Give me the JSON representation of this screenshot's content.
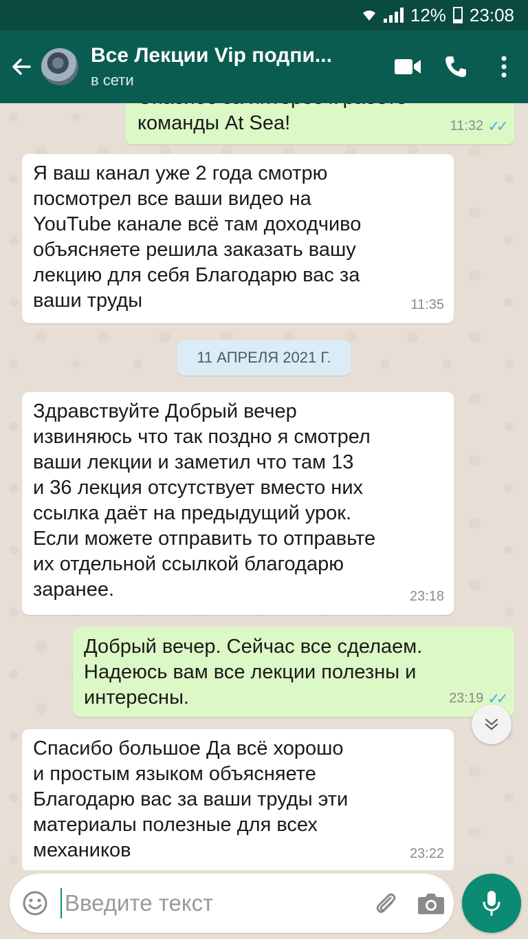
{
  "status_bar": {
    "battery": "12%",
    "time": "23:08"
  },
  "header": {
    "title": "Все Лекции Vip подпи...",
    "status": "в сети"
  },
  "messages": [
    {
      "direction": "out",
      "text": "Спасибо за интерес к работе\nкоманды At Sea!",
      "time": "11:32",
      "read": true
    },
    {
      "direction": "in",
      "text": "Я ваш канал уже 2 года смотрю\nпосмотрел все ваши видео  на\nYouTube канале всё там доходчиво\nобъясняете решила заказать вашу\nлекцию для себя Благодарю вас за\nваши труды",
      "time": "11:35"
    },
    {
      "direction": "in",
      "text": "Здравствуйте Добрый вечер\nизвиняюсь что так поздно я смотрел\nваши лекции и заметил что там 13\nи 36 лекция отсутствует вместо них\nссылка даёт на предыдущий урок.\nЕсли можете отправить то отправьте\nих отдельной ссылкой благодарю\nзаранее.",
      "time": "23:18"
    },
    {
      "direction": "out",
      "text": "Добрый вечер. Сейчас все сделаем.\nНадеюсь вам все лекции полезны и\nинтересны.",
      "time": "23:19",
      "read": true
    },
    {
      "direction": "in",
      "text": "Спасибо большое Да всё  хорошо\nи простым языком объясняете\nБлагодарю вас за ваши труды эти\nматериалы полезные для всех\nмехаников",
      "time": "23:22"
    }
  ],
  "date_separator": "11 АПРЕЛЯ 2021 Г.",
  "composer": {
    "placeholder": "Введите текст"
  },
  "icons": {
    "back": "arrow-left-icon",
    "video": "video-camera-icon",
    "call": "phone-icon",
    "menu": "more-vertical-icon",
    "emoji": "emoji-icon",
    "attach": "paperclip-icon",
    "camera": "camera-icon",
    "mic": "microphone-icon",
    "scroll": "chevron-down-icon"
  },
  "colors": {
    "header": "#0b5c50",
    "status_bar": "#0a4a3f",
    "outgoing": "#dcf8c6",
    "incoming": "#ffffff",
    "accent": "#0b8a74",
    "read_ticks": "#4fb3e0"
  }
}
